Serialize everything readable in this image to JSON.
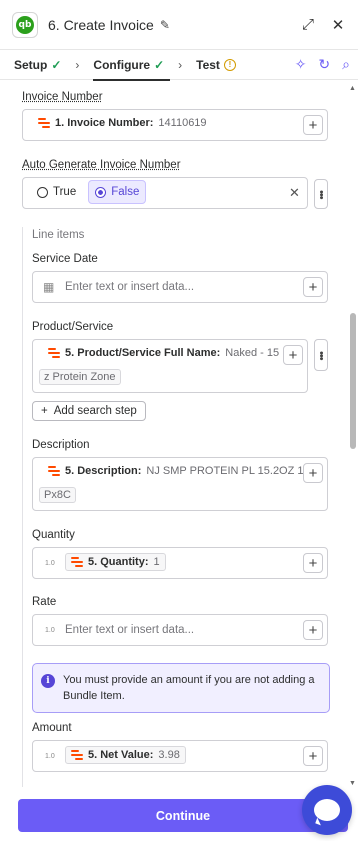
{
  "header": {
    "app_logo_text": "qb",
    "title": "6. Create Invoice"
  },
  "tabs": [
    {
      "label": "Setup"
    },
    {
      "label": "Configure"
    },
    {
      "label": "Test"
    }
  ],
  "fields": {
    "invoice_number": {
      "label": "Invoice Number",
      "pill_key": "1. Invoice Number:",
      "pill_value": "14110619"
    },
    "auto_generate": {
      "label": "Auto Generate Invoice Number",
      "option_true": "True",
      "option_false": "False",
      "selected": "False"
    },
    "line_items": {
      "label": "Line items"
    },
    "service_date": {
      "label": "Service Date",
      "placeholder": "Enter text or insert data..."
    },
    "product_service": {
      "label": "Product/Service",
      "pill_key": "5. Product/Service Full Name:",
      "pill_value": "Naked - 15",
      "pill_value_cont": "z Protein Zone"
    },
    "add_search_step": "Add search step",
    "description": {
      "label": "Description",
      "pill_key": "5. Description:",
      "pill_value": "NJ SMP PROTEIN PL 15.2OZ 1",
      "pill_value_cont": "Px8C"
    },
    "quantity": {
      "label": "Quantity",
      "num_icon": "1.0",
      "pill_key": "5. Quantity:",
      "pill_value": "1"
    },
    "rate": {
      "label": "Rate",
      "num_icon": "1.0",
      "placeholder": "Enter text or insert data..."
    },
    "info_message": "You must provide an amount if you are not adding a Bundle Item.",
    "amount": {
      "label": "Amount",
      "num_icon": "1.0",
      "pill_key": "5. Net Value:",
      "pill_value": "3.98"
    }
  },
  "footer": {
    "continue_label": "Continue"
  },
  "colors": {
    "accent": "#6b5cf6",
    "zapier_orange": "#ff4a00",
    "success": "#1f9d55",
    "warning": "#d39b00",
    "chat": "#3d4bd8"
  }
}
